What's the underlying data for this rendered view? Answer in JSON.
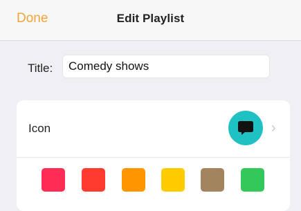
{
  "header": {
    "done_label": "Done",
    "title": "Edit Playlist",
    "accent_color": "#f0a43a"
  },
  "title_field": {
    "label": "Title:",
    "value": "Comedy shows"
  },
  "icon_row": {
    "label": "Icon",
    "icon_name": "speech-bubble-icon",
    "icon_bg_color": "#1fc1c3",
    "chevron": "›"
  },
  "colors": [
    {
      "name": "pink",
      "hex": "#ff2d55"
    },
    {
      "name": "red",
      "hex": "#ff3b30"
    },
    {
      "name": "orange",
      "hex": "#ff9500"
    },
    {
      "name": "yellow",
      "hex": "#ffcc00"
    },
    {
      "name": "brown",
      "hex": "#a2845e"
    },
    {
      "name": "green",
      "hex": "#34c759"
    }
  ]
}
